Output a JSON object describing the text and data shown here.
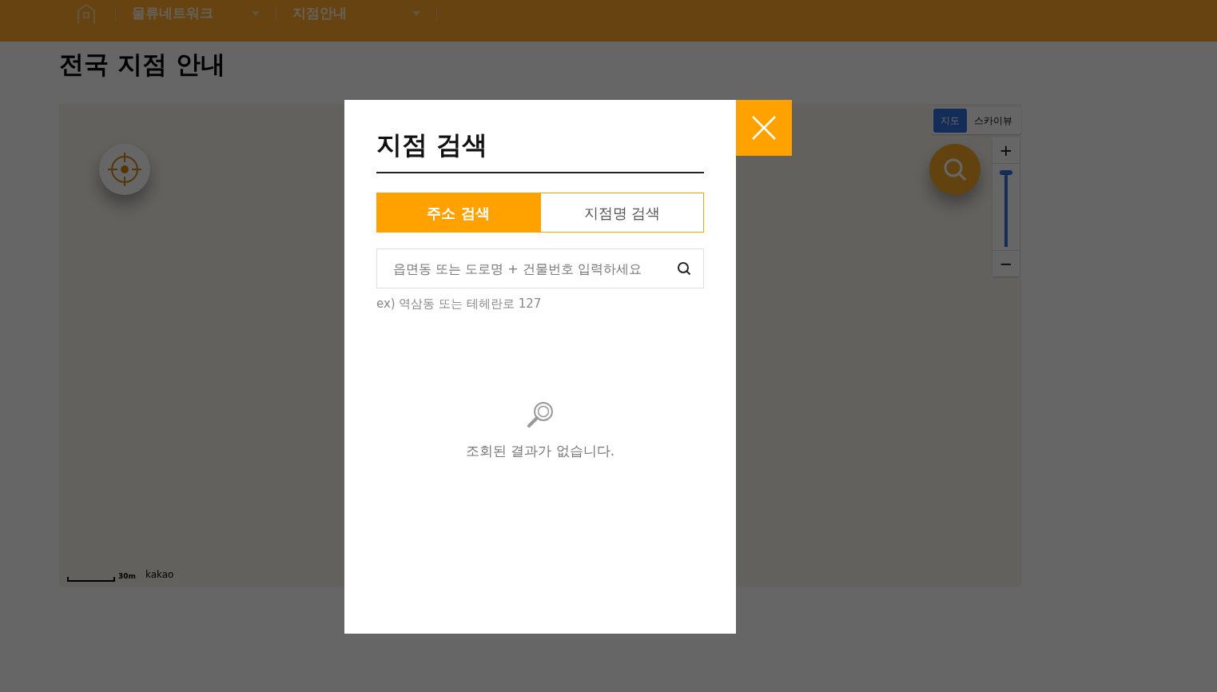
{
  "header": {
    "nav": [
      {
        "label": "물류네트워크"
      },
      {
        "label": "지점안내"
      }
    ]
  },
  "page_title": "전국 지점 안내",
  "map": {
    "map_types": [
      {
        "label": "지도",
        "selected": true
      },
      {
        "label": "스카이뷰",
        "selected": false
      }
    ],
    "zoom": {
      "in": "+",
      "out": "−",
      "level": 0.97
    },
    "scale": "30m",
    "logo": "kakao"
  },
  "modal": {
    "title": "지점 검색",
    "tabs": [
      {
        "label": "주소 검색",
        "selected": true
      },
      {
        "label": "지점명 검색",
        "selected": false
      }
    ],
    "search": {
      "placeholder": "읍면동 또는 도로명 + 건물번호 입력하세요"
    },
    "hint": "ex) 역삼동 또는 테헤란로 127",
    "empty_message": "조회된 결과가 없습니다."
  }
}
